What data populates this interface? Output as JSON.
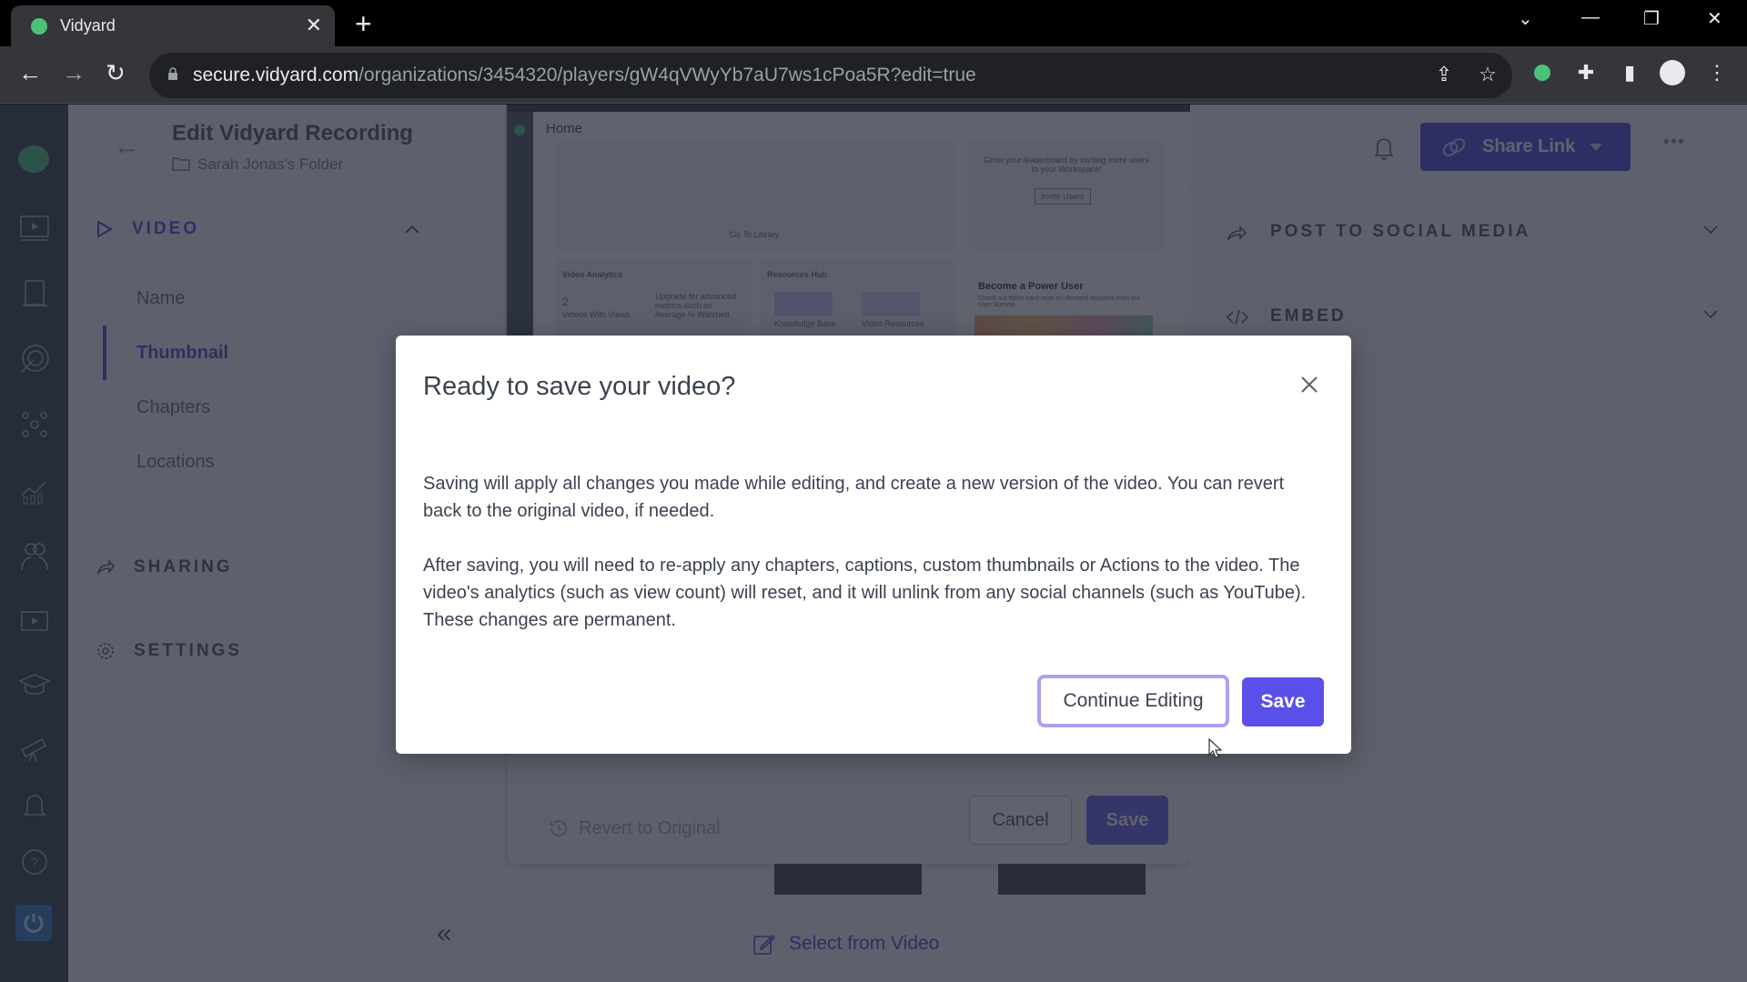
{
  "browser": {
    "tab_title": "Vidyard",
    "url_host": "secure.vidyard.com",
    "url_path": "/organizations/3454320/players/gW4qVWyYb7aU7ws1cPoa5R?edit=true"
  },
  "header": {
    "title": "Edit Vidyard Recording",
    "folder": "Sarah Jonas's Folder"
  },
  "leftnav": {
    "video_section": "VIDEO",
    "video_items": [
      "Name",
      "Thumbnail",
      "Chapters",
      "Locations"
    ],
    "active_item": "Thumbnail",
    "sharing_section": "SHARING",
    "settings_section": "SETTINGS"
  },
  "preview": {
    "home_label": "Home",
    "leaderboard_text": "Grow your leaderboard by inviting more users to your Workspace!",
    "invite_users": "Invite Users",
    "go_to_library": "Go To Library",
    "video_analytics": "Video Analytics",
    "videos_with_views_count": "2",
    "videos_with_views": "Videos With Views",
    "upgrade_text": "Upgrade for advanced metrics such as Average % Watched",
    "resources_hub": "Resources Hub",
    "knowledge_base": "Knowledge Base",
    "video_resources": "Video Resources",
    "power_user_title": "Become a Power User",
    "power_user_text": "Check out these can't miss on-demand sessions from our User Summit"
  },
  "editor": {
    "revert": "Revert to Original",
    "cancel": "Cancel",
    "save": "Save",
    "select_from_video": "Select from Video"
  },
  "rightpanel": {
    "share_link": "Share Link",
    "more": "•••",
    "post_to_social": "POST TO SOCIAL MEDIA",
    "embed": "EMBED"
  },
  "modal": {
    "title": "Ready to save your video?",
    "paragraph1": "Saving will apply all changes you made while editing, and create a new version of the video. You can revert back to the original video, if needed.",
    "paragraph2": "After saving, you will need to re-apply any chapters, captions, custom thumbnails or Actions to the video. The video's analytics (such as view count) will reset, and it will unlink from any social channels (such as YouTube). These changes are permanent.",
    "continue_editing": "Continue Editing",
    "save": "Save"
  },
  "colors": {
    "accent": "#5a4fe9",
    "share_button": "#3d36d6",
    "continue_border": "#a9a2f0",
    "rail": "#262c3c"
  }
}
